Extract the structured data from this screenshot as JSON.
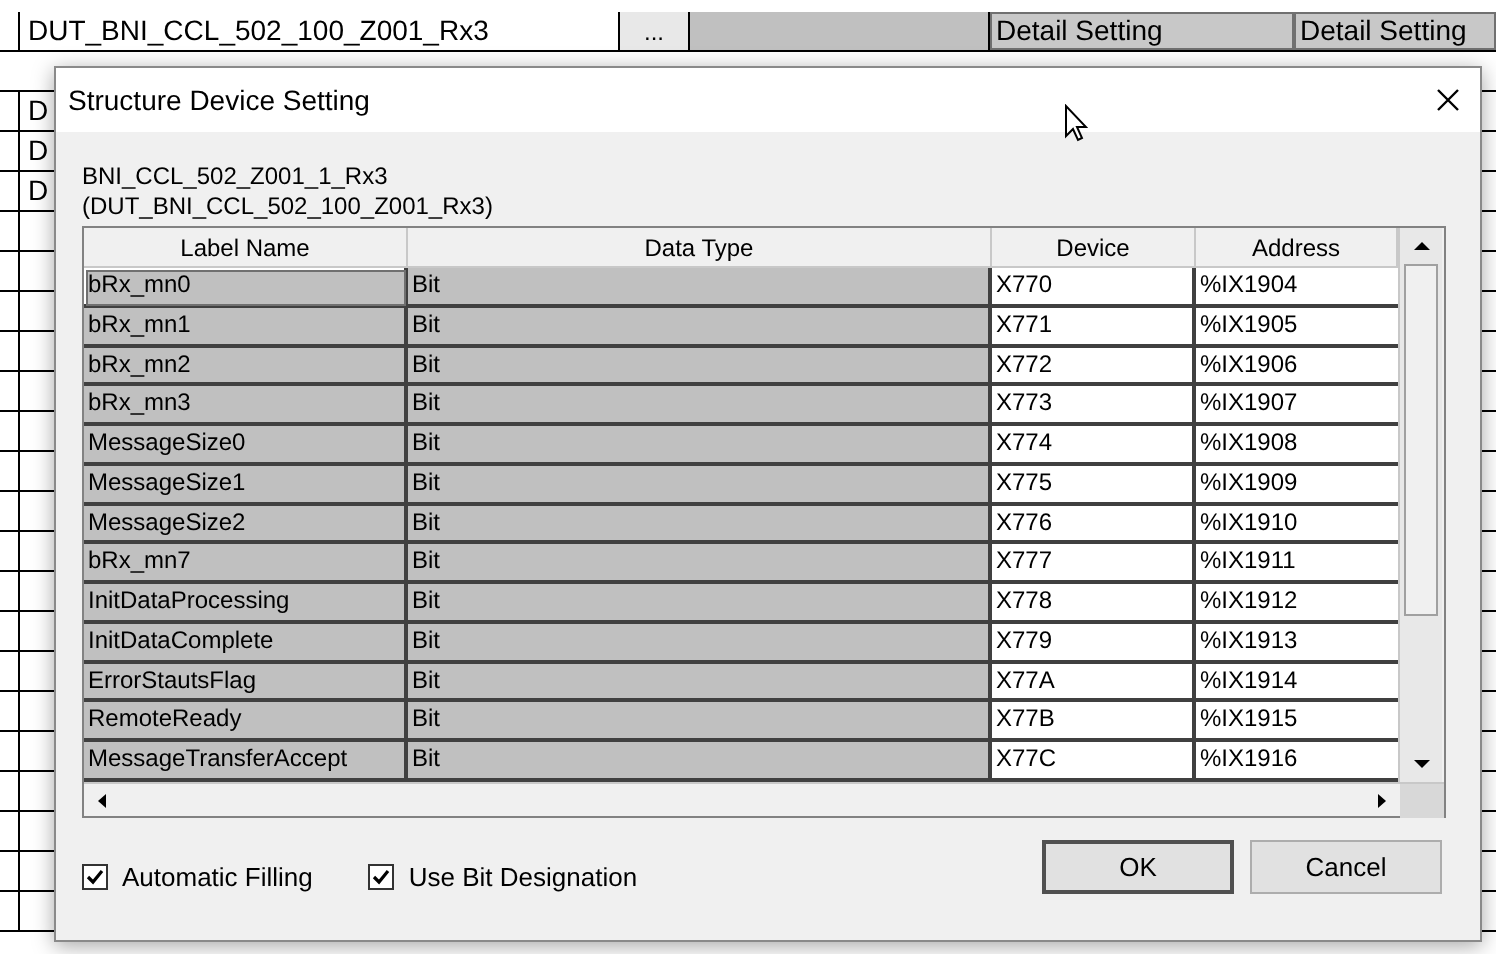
{
  "background_grid": {
    "rows": [
      {
        "name": "DUT_BNI_CCL_502_100_Z001_Rx3",
        "browse": "...",
        "setting_1": "Detail Setting",
        "setting_2": "Detail Setting"
      }
    ],
    "left_cells": [
      "D",
      "D",
      "D"
    ]
  },
  "dialog": {
    "title": "Structure Device Setting",
    "subtitle_1": "BNI_CCL_502_Z001_1_Rx3",
    "subtitle_2": "(DUT_BNI_CCL_502_100_Z001_Rx3)",
    "table": {
      "columns": [
        "Label Name",
        "Data Type",
        "Device",
        "Address"
      ],
      "rows": [
        {
          "label": "bRx_mn0",
          "type": "Bit",
          "device": "X770",
          "address": "%IX1904",
          "focused": true
        },
        {
          "label": "bRx_mn1",
          "type": "Bit",
          "device": "X771",
          "address": "%IX1905",
          "focused": false
        },
        {
          "label": "bRx_mn2",
          "type": "Bit",
          "device": "X772",
          "address": "%IX1906",
          "focused": false
        },
        {
          "label": "bRx_mn3",
          "type": "Bit",
          "device": "X773",
          "address": "%IX1907",
          "focused": false
        },
        {
          "label": "MessageSize0",
          "type": "Bit",
          "device": "X774",
          "address": "%IX1908",
          "focused": false
        },
        {
          "label": "MessageSize1",
          "type": "Bit",
          "device": "X775",
          "address": "%IX1909",
          "focused": false
        },
        {
          "label": "MessageSize2",
          "type": "Bit",
          "device": "X776",
          "address": "%IX1910",
          "focused": false
        },
        {
          "label": "bRx_mn7",
          "type": "Bit",
          "device": "X777",
          "address": "%IX1911",
          "focused": false
        },
        {
          "label": "InitDataProcessing",
          "type": "Bit",
          "device": "X778",
          "address": "%IX1912",
          "focused": false
        },
        {
          "label": "InitDataComplete",
          "type": "Bit",
          "device": "X779",
          "address": "%IX1913",
          "focused": false
        },
        {
          "label": "ErrorStautsFlag",
          "type": "Bit",
          "device": "X77A",
          "address": "%IX1914",
          "focused": false
        },
        {
          "label": "RemoteReady",
          "type": "Bit",
          "device": "X77B",
          "address": "%IX1915",
          "focused": false
        },
        {
          "label": "MessageTransferAccept",
          "type": "Bit",
          "device": "X77C",
          "address": "%IX1916",
          "focused": false
        }
      ]
    },
    "options": [
      {
        "label": "Automatic Filling",
        "checked": true
      },
      {
        "label": "Use Bit Designation",
        "checked": true
      }
    ],
    "buttons": [
      {
        "label": "OK",
        "default": true
      },
      {
        "label": "Cancel",
        "default": false
      }
    ]
  }
}
